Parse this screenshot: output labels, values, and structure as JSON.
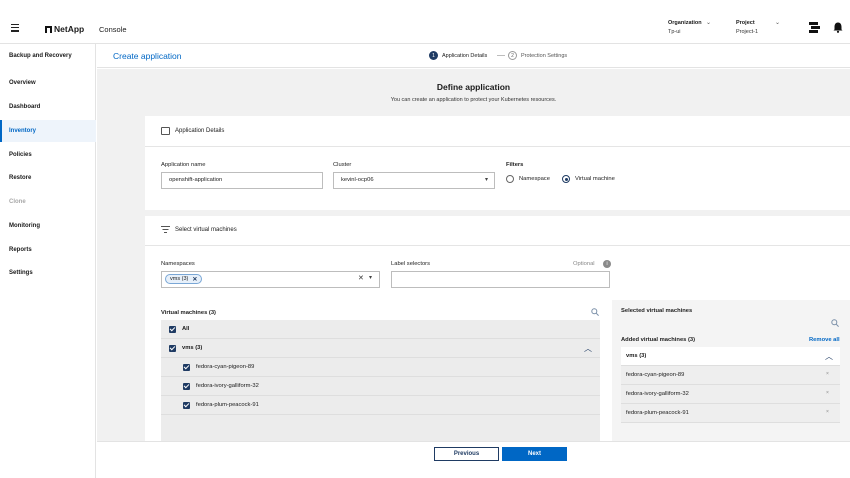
{
  "topbar": {
    "brand": "NetApp",
    "console": "Console",
    "organization_label": "Organization",
    "organization_value": "Tp-ui",
    "project_label": "Project",
    "project_value": "Project-1"
  },
  "sidebar": {
    "title": "Backup and Recovery",
    "items": [
      {
        "label": "Overview",
        "state": "normal"
      },
      {
        "label": "Dashboard",
        "state": "normal"
      },
      {
        "label": "Inventory",
        "state": "active"
      },
      {
        "label": "Policies",
        "state": "normal"
      },
      {
        "label": "Restore",
        "state": "normal"
      },
      {
        "label": "Clone",
        "state": "disabled"
      },
      {
        "label": "Monitoring",
        "state": "normal"
      },
      {
        "label": "Reports",
        "state": "normal"
      },
      {
        "label": "Settings",
        "state": "normal"
      }
    ]
  },
  "subheader": {
    "title": "Create application",
    "steps": [
      {
        "num": "1",
        "label": "Application Details",
        "active": true
      },
      {
        "num": "2",
        "label": "Protection Settings",
        "active": false
      }
    ]
  },
  "define": {
    "title": "Define application",
    "subtitle": "You can create an application to protect your Kubernetes resources."
  },
  "app_details": {
    "title": "Application Details",
    "app_name_label": "Application name",
    "app_name_value": "openshift-application",
    "cluster_label": "Cluster",
    "cluster_value": "kevinl-ocp06",
    "filters_label": "Filters",
    "filter_options": [
      "Namespace",
      "Virtual machine"
    ],
    "filter_selected": "Virtual machine"
  },
  "select_vms": {
    "title": "Select virtual machines",
    "namespaces_label": "Namespaces",
    "namespace_chip": "vms (3)",
    "label_selectors_label": "Label selectors",
    "optional": "Optional",
    "vm_list_title": "Virtual machines (3)",
    "all_label": "All",
    "group_label": "vms (3)",
    "vms": [
      "fedora-cyan-pigeon-89",
      "fedora-ivory-galliform-32",
      "fedora-plum-peacock-91"
    ],
    "selected_title": "Selected virtual machines",
    "added_title": "Added virtual machines (3)",
    "remove_all": "Remove all",
    "selected_group": "vms (3)",
    "selected_vms": [
      "fedora-cyan-pigeon-89",
      "fedora-ivory-galliform-32",
      "fedora-plum-peacock-91"
    ]
  },
  "footer": {
    "previous": "Previous",
    "next": "Next"
  },
  "colors": {
    "accent": "#0067c5",
    "navy": "#1f3b63",
    "background": "#f1f1f1"
  },
  "icons": {
    "menu": "hamburger-menu-icon",
    "switcher": "workspace-switcher-icon",
    "notifications": "bell-icon",
    "search": "search-icon",
    "info": "info-icon",
    "caret": "chevron-down-icon",
    "collapse": "chevron-up-icon"
  }
}
